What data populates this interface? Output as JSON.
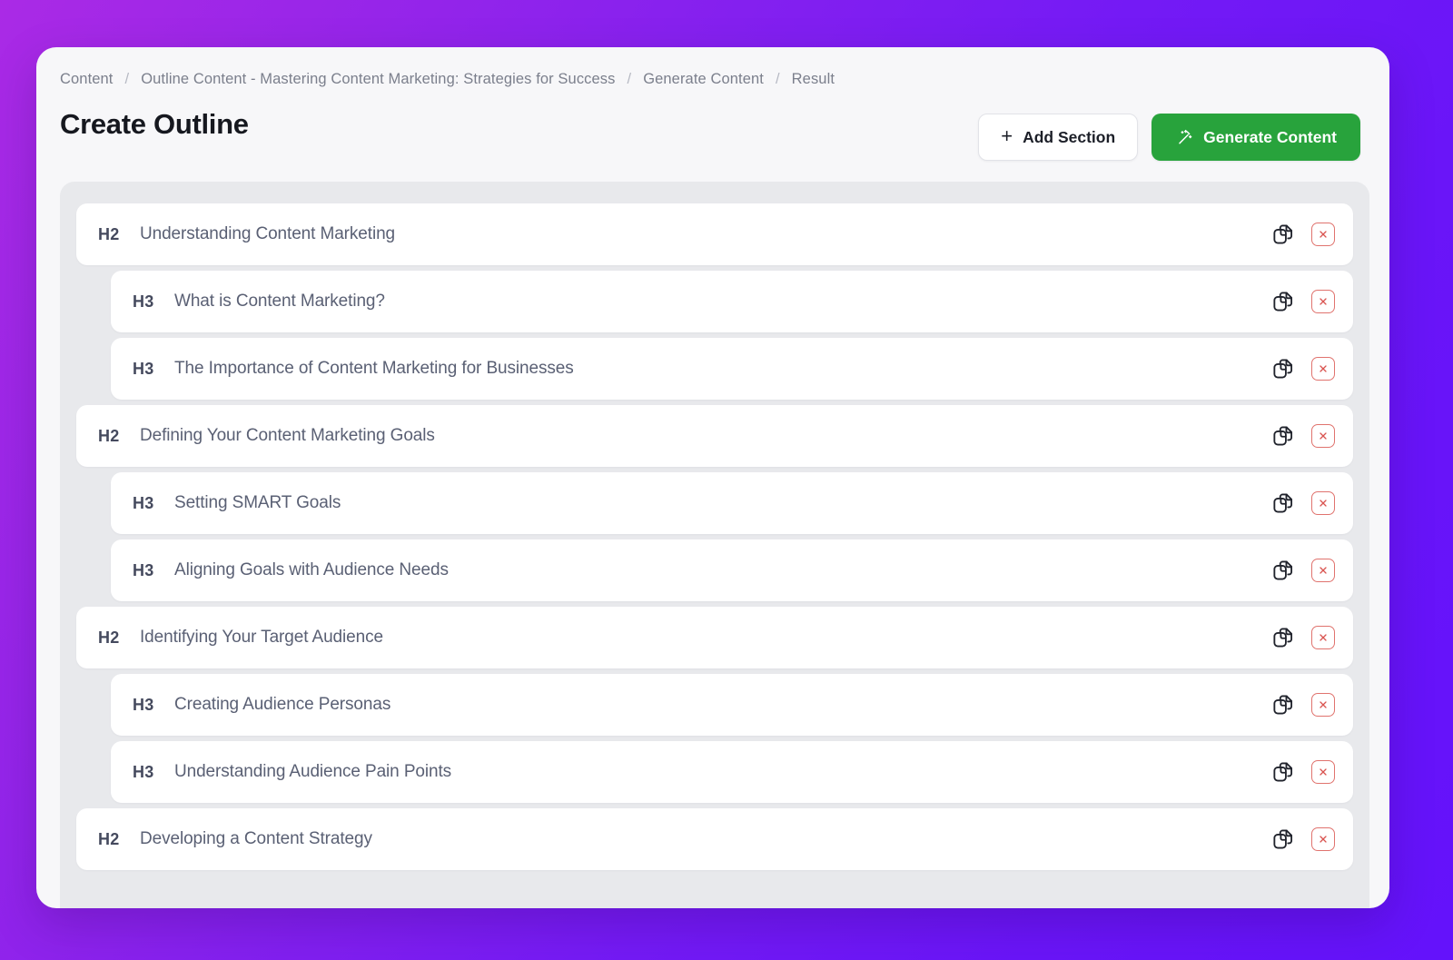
{
  "breadcrumb": {
    "separator": "/",
    "items": [
      "Content",
      "Outline Content - Mastering Content Marketing: Strategies for Success",
      "Generate Content",
      "Result"
    ]
  },
  "header": {
    "title": "Create Outline",
    "add_section_label": "Add Section",
    "add_section_icon": "plus-icon",
    "generate_content_label": "Generate Content",
    "generate_content_icon": "magic-wand-icon",
    "primary_color": "#28a33c"
  },
  "outline": {
    "row_duplicate_icon": "duplicate-icon",
    "row_delete_icon": "close-x-icon",
    "rows": [
      {
        "level": "H2",
        "title": "Understanding Content Marketing"
      },
      {
        "level": "H3",
        "title": "What is Content Marketing?"
      },
      {
        "level": "H3",
        "title": "The Importance of Content Marketing for Businesses"
      },
      {
        "level": "H2",
        "title": "Defining Your Content Marketing Goals"
      },
      {
        "level": "H3",
        "title": "Setting SMART Goals"
      },
      {
        "level": "H3",
        "title": "Aligning Goals with Audience Needs"
      },
      {
        "level": "H2",
        "title": "Identifying Your Target Audience"
      },
      {
        "level": "H3",
        "title": "Creating Audience Personas"
      },
      {
        "level": "H3",
        "title": "Understanding Audience Pain Points"
      },
      {
        "level": "H2",
        "title": "Developing a Content Strategy"
      }
    ]
  }
}
